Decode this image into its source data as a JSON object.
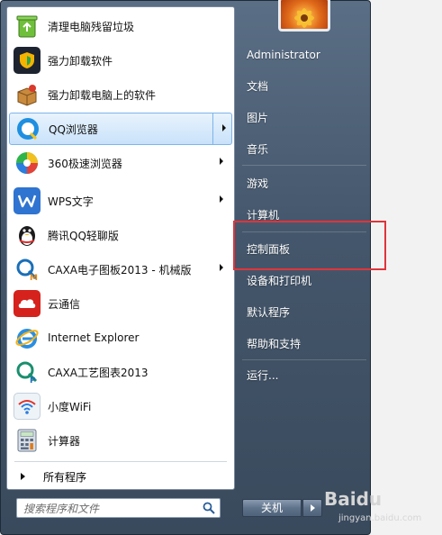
{
  "programs": [
    {
      "label": "清理电脑残留垃圾",
      "icon": "recycle-bin-icon",
      "has_arrow": false
    },
    {
      "label": "强力卸载软件",
      "icon": "uninstall-shield-icon",
      "has_arrow": false
    },
    {
      "label": "强力卸载电脑上的软件",
      "icon": "box-uninstall-icon",
      "has_arrow": false
    },
    {
      "label": "QQ浏览器",
      "icon": "qq-browser-icon",
      "has_arrow": true,
      "highlighted": true
    },
    {
      "label": "360极速浏览器",
      "icon": "360-browser-icon",
      "has_arrow": true
    },
    {
      "label": "WPS文字",
      "icon": "wps-writer-icon",
      "has_arrow": true
    },
    {
      "label": "腾讯QQ轻聊版",
      "icon": "qq-penguin-icon",
      "has_arrow": false
    },
    {
      "label": "CAXA电子图板2013 - 机械版",
      "icon": "caxa-draft-icon",
      "has_arrow": true
    },
    {
      "label": "云通信",
      "icon": "cloud-263-icon",
      "has_arrow": false
    },
    {
      "label": "Internet Explorer",
      "icon": "internet-explorer-icon",
      "has_arrow": false
    },
    {
      "label": "CAXA工艺图表2013",
      "icon": "caxa-process-icon",
      "has_arrow": false
    },
    {
      "label": "小度WiFi",
      "icon": "wifi-icon",
      "has_arrow": false
    },
    {
      "label": "计算器",
      "icon": "calculator-icon",
      "has_arrow": false
    }
  ],
  "all_programs": "所有程序",
  "search": {
    "placeholder": "搜索程序和文件"
  },
  "right_menu": [
    {
      "label": "Administrator"
    },
    {
      "label": "文档"
    },
    {
      "label": "图片"
    },
    {
      "label": "音乐"
    },
    {
      "label": "游戏"
    },
    {
      "label": "计算机"
    },
    {
      "label": "控制面板",
      "highlighted_box": true
    },
    {
      "label": "设备和打印机"
    },
    {
      "label": "默认程序"
    },
    {
      "label": "帮助和支持"
    },
    {
      "label": "运行..."
    }
  ],
  "shutdown": {
    "label": "关机"
  },
  "watermark": {
    "logo_text": "Baidu",
    "url": "jingyan.baidu.com"
  },
  "colors": {
    "highlight_box": "#e0343a",
    "menu_bg": "#44566b"
  }
}
